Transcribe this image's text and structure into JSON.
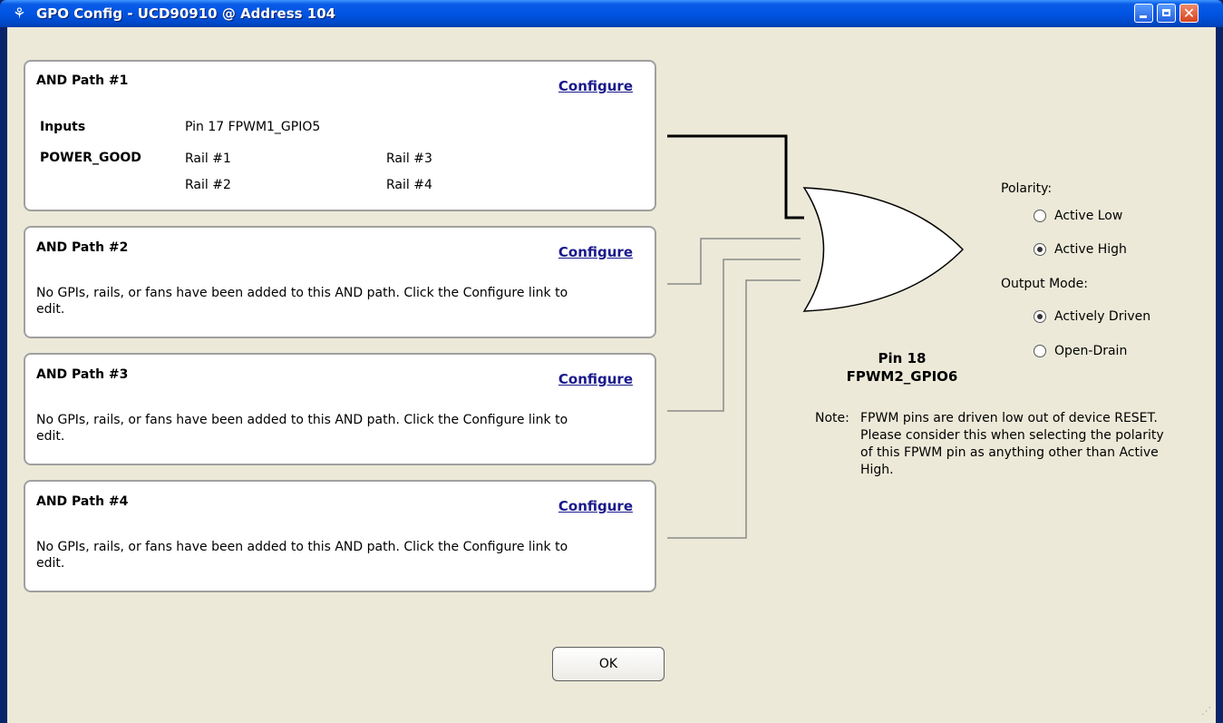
{
  "window": {
    "title": "GPO Config - UCD90910 @ Address 104",
    "icon": "ti-logo-icon",
    "controls": {
      "minimize": "minimize-icon",
      "maximize": "maximize-icon",
      "close_glyph": "✕"
    }
  },
  "paths": [
    {
      "title": "AND Path #1",
      "configure": "Configure",
      "inputs_label": "Inputs",
      "inputs_value": "Pin 17 FPWM1_GPIO5",
      "pg_label": "POWER_GOOD",
      "rails": [
        "Rail #1",
        "Rail #2",
        "Rail #3",
        "Rail #4"
      ]
    },
    {
      "title": "AND Path #2",
      "configure": "Configure",
      "message": "No GPIs, rails, or fans have been added to this AND path. Click the Configure link to edit."
    },
    {
      "title": "AND Path #3",
      "configure": "Configure",
      "message": "No GPIs, rails, or fans have been added to this AND path. Click the Configure link to edit."
    },
    {
      "title": "AND Path #4",
      "configure": "Configure",
      "message": "No GPIs, rails, or fans have been added to this AND path. Click the Configure link to edit."
    }
  ],
  "output": {
    "pin_line1": "Pin 18",
    "pin_line2": "FPWM2_GPIO6",
    "note_lead": "Note:",
    "note_body": "FPWM pins are driven low out of device RESET. Please consider this when selecting the polarity of this FPWM pin as anything other than Active High."
  },
  "polarity": {
    "label": "Polarity:",
    "options": [
      {
        "label": "Active Low",
        "checked": false
      },
      {
        "label": "Active High",
        "checked": true
      }
    ]
  },
  "output_mode": {
    "label": "Output Mode:",
    "options": [
      {
        "label": "Actively Driven",
        "checked": true
      },
      {
        "label": "Open-Drain",
        "checked": false
      }
    ]
  },
  "ok_button": "OK"
}
